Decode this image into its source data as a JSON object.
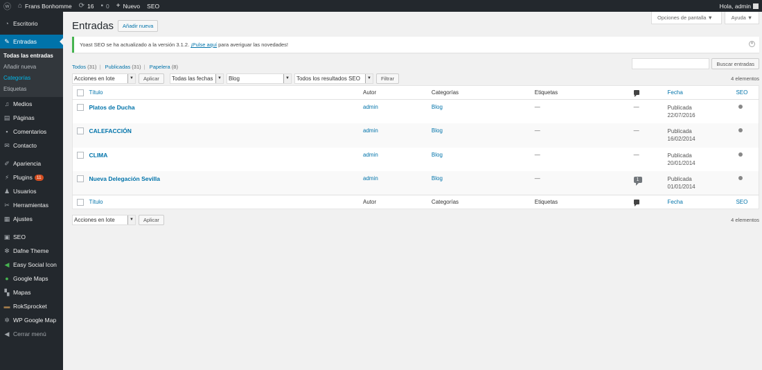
{
  "adminbar": {
    "site_name": "Frans Bonhomme",
    "updates_count": "16",
    "comments_count": "0",
    "new_label": "Nuevo",
    "seo_label": "SEO",
    "greeting": "Hola, admin"
  },
  "sidebar": {
    "items": [
      {
        "label": "Escritorio",
        "icon": "dashboard-icon"
      },
      {
        "label": "Entradas",
        "icon": "pin-icon"
      },
      {
        "label": "Medios",
        "icon": "media-icon"
      },
      {
        "label": "Páginas",
        "icon": "pages-icon"
      },
      {
        "label": "Comentarios",
        "icon": "comments-icon"
      },
      {
        "label": "Contacto",
        "icon": "mail-icon"
      },
      {
        "label": "Apariencia",
        "icon": "brush-icon"
      },
      {
        "label": "Plugins",
        "icon": "plugin-icon",
        "badge": "11"
      },
      {
        "label": "Usuarios",
        "icon": "users-icon"
      },
      {
        "label": "Herramientas",
        "icon": "wrench-icon"
      },
      {
        "label": "Ajustes",
        "icon": "settings-icon"
      },
      {
        "label": "SEO",
        "icon": "yoast-icon"
      },
      {
        "label": "Dafne Theme",
        "icon": "gear-icon"
      },
      {
        "label": "Easy Social Icon",
        "icon": "share-icon"
      },
      {
        "label": "Google Maps",
        "icon": "map-pin-icon"
      },
      {
        "label": "Mapas",
        "icon": "map-icon"
      },
      {
        "label": "RokSprocket",
        "icon": "box-icon"
      },
      {
        "label": "WP Google Map",
        "icon": "cog-icon"
      },
      {
        "label": "Cerrar menú",
        "icon": "collapse-icon"
      }
    ],
    "submenu": [
      {
        "label": "Todas las entradas"
      },
      {
        "label": "Añadir nueva"
      },
      {
        "label": "Categorías"
      },
      {
        "label": "Etiquetas"
      }
    ]
  },
  "header": {
    "screen_options": "Opciones de pantalla ▼",
    "help": "Ayuda ▼",
    "title": "Entradas",
    "add_new": "Añadir nueva"
  },
  "notice": {
    "text_before": "Yoast SEO se ha actualizado a la versión 3.1.2.",
    "link": "¡Pulse aquí",
    "text_after": "para averiguar las novedades!"
  },
  "filters": {
    "all": "Todos",
    "all_count": "(31)",
    "published": "Publicadas",
    "published_count": "(31)",
    "trash": "Papelera",
    "trash_count": "(8)",
    "search_button": "Buscar entradas",
    "bulk_action": "Acciones en lote",
    "apply": "Aplicar",
    "all_dates": "Todas las fechas",
    "category": "Blog",
    "seo_filter": "Todos los resultados SEO",
    "filter_button": "Filtrar",
    "items_count": "4 elementos"
  },
  "table": {
    "columns": {
      "title": "Título",
      "author": "Autor",
      "categories": "Categorías",
      "tags": "Etiquetas",
      "date": "Fecha",
      "seo": "SEO"
    },
    "rows": [
      {
        "title": "Platos de Ducha",
        "author": "admin",
        "category": "Blog",
        "tags": "—",
        "comments": "—",
        "status": "Publicada",
        "date": "22/07/2016"
      },
      {
        "title": "CALEFACCIÓN",
        "author": "admin",
        "category": "Blog",
        "tags": "—",
        "comments": "—",
        "status": "Publicada",
        "date": "16/02/2014"
      },
      {
        "title": "CLIMA",
        "author": "admin",
        "category": "Blog",
        "tags": "—",
        "comments": "—",
        "status": "Publicada",
        "date": "20/01/2014"
      },
      {
        "title": "Nueva Delegación Sevilla",
        "author": "admin",
        "category": "Blog",
        "tags": "—",
        "comments": "1",
        "status": "Publicada",
        "date": "01/01/2014"
      }
    ]
  }
}
